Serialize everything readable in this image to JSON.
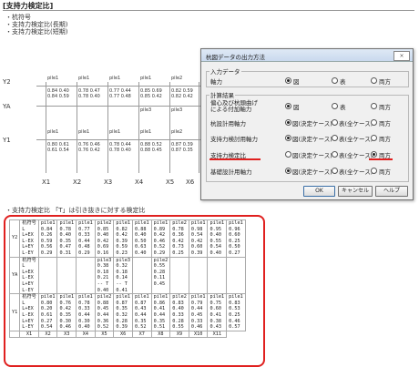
{
  "header": {
    "title": "[支持力検定比]",
    "items": [
      "・杭符号",
      "・支持力検定比(長期)",
      "・支持力検定比(短期)"
    ]
  },
  "plan": {
    "row_labels": [
      "Y2",
      "YA",
      "Y1"
    ],
    "col_labels": [
      "X1",
      "X2",
      "X3",
      "X4",
      "X5",
      "X6"
    ],
    "y2_piles": [
      "pile1",
      "pile1",
      "pile1",
      "pile1",
      "pile2",
      "pile1",
      "pile1",
      "pile2",
      "pile1",
      "pile1",
      "pile1"
    ],
    "y1_piles": [
      "pile1",
      "pile1",
      "pile1",
      "pile1",
      "pile2",
      "pile1",
      "pile1",
      "pile2",
      "pile1",
      "pile1",
      "pile1"
    ],
    "ya_piles": [
      "pile3",
      "pile3",
      "pile2"
    ]
  },
  "note": "・支持力検定比  「T」は引き抜きに対する検定比",
  "table": {
    "row_y2": [
      "杭符号\nL\nL+EX\nL-EX\nL+EY\nL-EY",
      "pile1\n0.84\n0.26\n0.59\n0.56\n0.29",
      "pile1\n0.78\n0.40\n0.35\n0.47\n0.31",
      "pile1\n0.77\n0.33\n0.44\n0.48\n0.29",
      "pile2\n0.85\n0.40\n0.42\n0.69\n0.16",
      "pile1\n0.82\n0.42\n0.39\n0.59\n0.23",
      "pile1\n0.88\n0.40\n0.50\n0.63\n0.40",
      "pile1\n0.89\n0.42\n0.46\n0.52\n0.29",
      "pile2\n0.78\n0.36\n0.42\n0.73\n0.25",
      "pile1\n0.98\n0.54\n0.42\n0.60\n0.39",
      "pile1\n0.95\n0.40\n0.55\n0.54\n0.40",
      "pile1\n0.96\n0.60\n0.25\n0.50\n0.27"
    ],
    "row_ya": [
      "杭符号\nL\nL+EX\nL-EX\nL+EY\nL-EY",
      "",
      "",
      "",
      "pile3\n0.38\n0.18\n0.21\n-- T\n0.40",
      "pile3\n0.32\n0.18\n0.14\n-- T\n0.41",
      "",
      "pile2\n0.55\n0.28\n0.11\n0.45",
      "",
      "",
      "",
      ""
    ],
    "row_y1": [
      "杭符号\nL\nL+EX\nL-EX\nL+EY\nL-EY",
      "pile1\n0.80\n0.20\n0.61\n0.27\n0.54",
      "pile1\n0.76\n0.42\n0.35\n0.30\n0.46",
      "pile1\n0.78\n0.33\n0.44\n0.30\n0.40",
      "pile2\n0.88\n0.45\n0.44\n0.36\n0.52",
      "pile1\n0.87\n0.35\n0.32\n0.28\n0.39",
      "pile1\n0.87\n0.43\n0.44\n0.35\n0.52",
      "pile1\n0.86\n0.41\n0.44\n0.35\n0.51",
      "pile2\n0.83\n0.40\n0.33\n0.28\n0.55",
      "pile1\n0.79\n0.44\n0.45\n0.33\n0.46",
      "pile1\n0.75\n0.60\n0.41\n0.38\n0.43",
      "pile1\n0.83\n0.53\n0.25\n0.46\n0.57"
    ],
    "row_labels": [
      "Y2",
      "YA",
      "Y1"
    ],
    "footer": [
      "",
      "X1",
      "X2",
      "X3",
      "X4",
      "X5",
      "X6",
      "X7",
      "X8",
      "X9",
      "X10",
      "X11"
    ]
  },
  "dialog": {
    "title": "杭図データの出力方法",
    "close": "×",
    "input_group": "入力データ",
    "axis_label": "軸力",
    "opt_fig": "図",
    "opt_table": "表",
    "opt_both": "両方",
    "calc_group": "計算結果",
    "rows": [
      {
        "label": "偏心及び杭頭曲げ\nによる付加軸力",
        "o1": "図",
        "o2": "表",
        "o3": "両方",
        "sel": 1
      },
      {
        "label": "杭設計用軸力",
        "o1": "図(決定ケース)",
        "o2": "表(全ケース)",
        "o3": "両方",
        "sel": 1
      },
      {
        "label": "支持力検討用軸力",
        "o1": "図(決定ケース)",
        "o2": "表(全ケース)",
        "o3": "両方",
        "sel": 1
      },
      {
        "label": "支持力検定比",
        "o1": "図(決定ケース)",
        "o2": "表(全ケース)",
        "o3": "両方",
        "sel": 3
      },
      {
        "label": "基礎設計用軸力",
        "o1": "図(決定ケース)",
        "o2": "表(全ケース)",
        "o3": "両方",
        "sel": 1
      }
    ],
    "ok": "OK",
    "cancel": "キャンセル",
    "help": "ヘルプ"
  },
  "colors": {
    "highlight": "#e0201f"
  }
}
